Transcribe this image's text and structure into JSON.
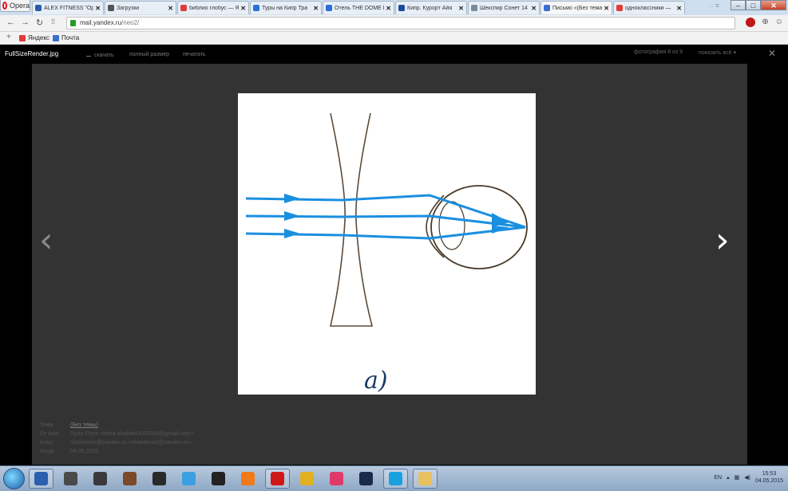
{
  "browser": {
    "menu_label": "Opera",
    "tabs": [
      {
        "title": "ALEX FITNESS \"Ope",
        "favicon_color": "#2d5aa7"
      },
      {
        "title": "Загрузки",
        "favicon_color": "#555555"
      },
      {
        "title": "библио глобус — Я",
        "favicon_color": "#e03a3a"
      },
      {
        "title": "Туры на Кипр Тра",
        "favicon_color": "#2a6fd6"
      },
      {
        "title": "Отель THE DOME K",
        "favicon_color": "#2a6fd6"
      },
      {
        "title": "Кипр. Курорт Айя",
        "favicon_color": "#1b4c9a"
      },
      {
        "title": "Шекспир Сонет 14",
        "favicon_color": "#7a8aa0"
      },
      {
        "title": "Письмо «(Без тема",
        "favicon_color": "#3a6fd0",
        "active": true
      },
      {
        "title": "одноклассники —",
        "favicon_color": "#e03a3a"
      }
    ],
    "url_domain": "mail.yandex.ru",
    "url_path": "/neo2/",
    "bookmarks": [
      {
        "label": "Яндекс",
        "icon_color": "#e03a3a"
      },
      {
        "label": "Почта",
        "icon_color": "#3a6fd0"
      }
    ]
  },
  "viewer": {
    "filename": "FullSizeRender.jpg",
    "download_label": "скачать",
    "fullsize_label": "полный размер",
    "print_label": "печатать",
    "counter": "фотография 8 из 9",
    "show_all": "показать всё ▾",
    "close_icon": "✕",
    "prev_icon": "‹",
    "next_icon": "›"
  },
  "photo": {
    "caption": "a)"
  },
  "meta": {
    "subject_label": "Тема",
    "subject_value": "(Без темы)",
    "from_label": "От кого",
    "from_value": "Ryan Flynn <dima.shaklein1020305@gmail.com>",
    "to_label": "Кому",
    "to_value": "shakleinas@yandex.ru <shakleinas@yandex.ru>",
    "date_label": "Когда",
    "date_value": "04.05.2015"
  },
  "taskbar": {
    "apps": [
      {
        "name": "word",
        "color": "#2b5fb0"
      },
      {
        "name": "counter-strike",
        "color": "#4a4a4a"
      },
      {
        "name": "game-1",
        "color": "#3a3a3a"
      },
      {
        "name": "game-2",
        "color": "#7a4a2a"
      },
      {
        "name": "game-3",
        "color": "#2a2a2a"
      },
      {
        "name": "download-manager",
        "color": "#3aa0e0"
      },
      {
        "name": "panda",
        "color": "#222222"
      },
      {
        "name": "office",
        "color": "#f07a1a"
      },
      {
        "name": "opera",
        "color": "#d01818"
      },
      {
        "name": "chrome",
        "color": "#e0b020"
      },
      {
        "name": "itunes",
        "color": "#e03a6a"
      },
      {
        "name": "steam",
        "color": "#1a2a4a"
      },
      {
        "name": "skype",
        "color": "#1aa0e0"
      },
      {
        "name": "explorer",
        "color": "#e8c060"
      }
    ],
    "lang": "EN",
    "time": "15:53",
    "date": "04.05.2015"
  }
}
